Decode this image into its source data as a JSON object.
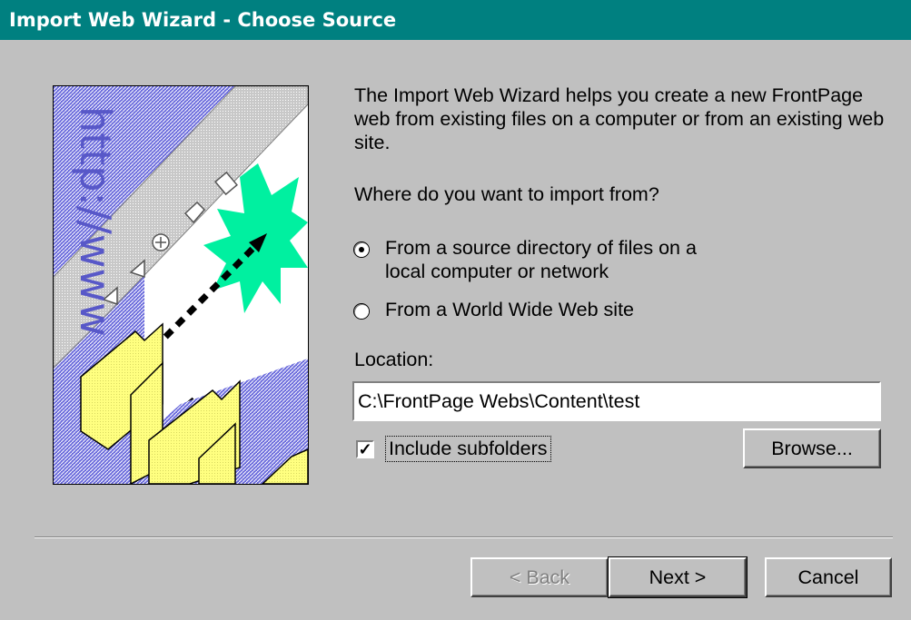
{
  "window": {
    "title": "Import Web Wizard - Choose Source"
  },
  "intro_text": "The Import Web Wizard helps you create a new FrontPage web from existing files on a computer or from an existing web site.",
  "question": "Where do you want to import from?",
  "options": [
    {
      "label_line1": "From a source directory of files on a",
      "label_line2": "local computer or network",
      "selected": true
    },
    {
      "label": "From a World Wide Web site",
      "selected": false
    }
  ],
  "location": {
    "label": "Location:",
    "value": "C:\\FrontPage Webs\\Content\\test"
  },
  "include_subfolders": {
    "label": "Include subfolders",
    "checked": true
  },
  "buttons": {
    "browse": "Browse...",
    "back": "< Back",
    "next": "Next >",
    "cancel": "Cancel"
  },
  "illustration": {
    "watermark_text": "http://www",
    "colors": {
      "blue": "#6b6bdc",
      "green": "#00f0a0",
      "yellow": "#ffff80"
    }
  }
}
